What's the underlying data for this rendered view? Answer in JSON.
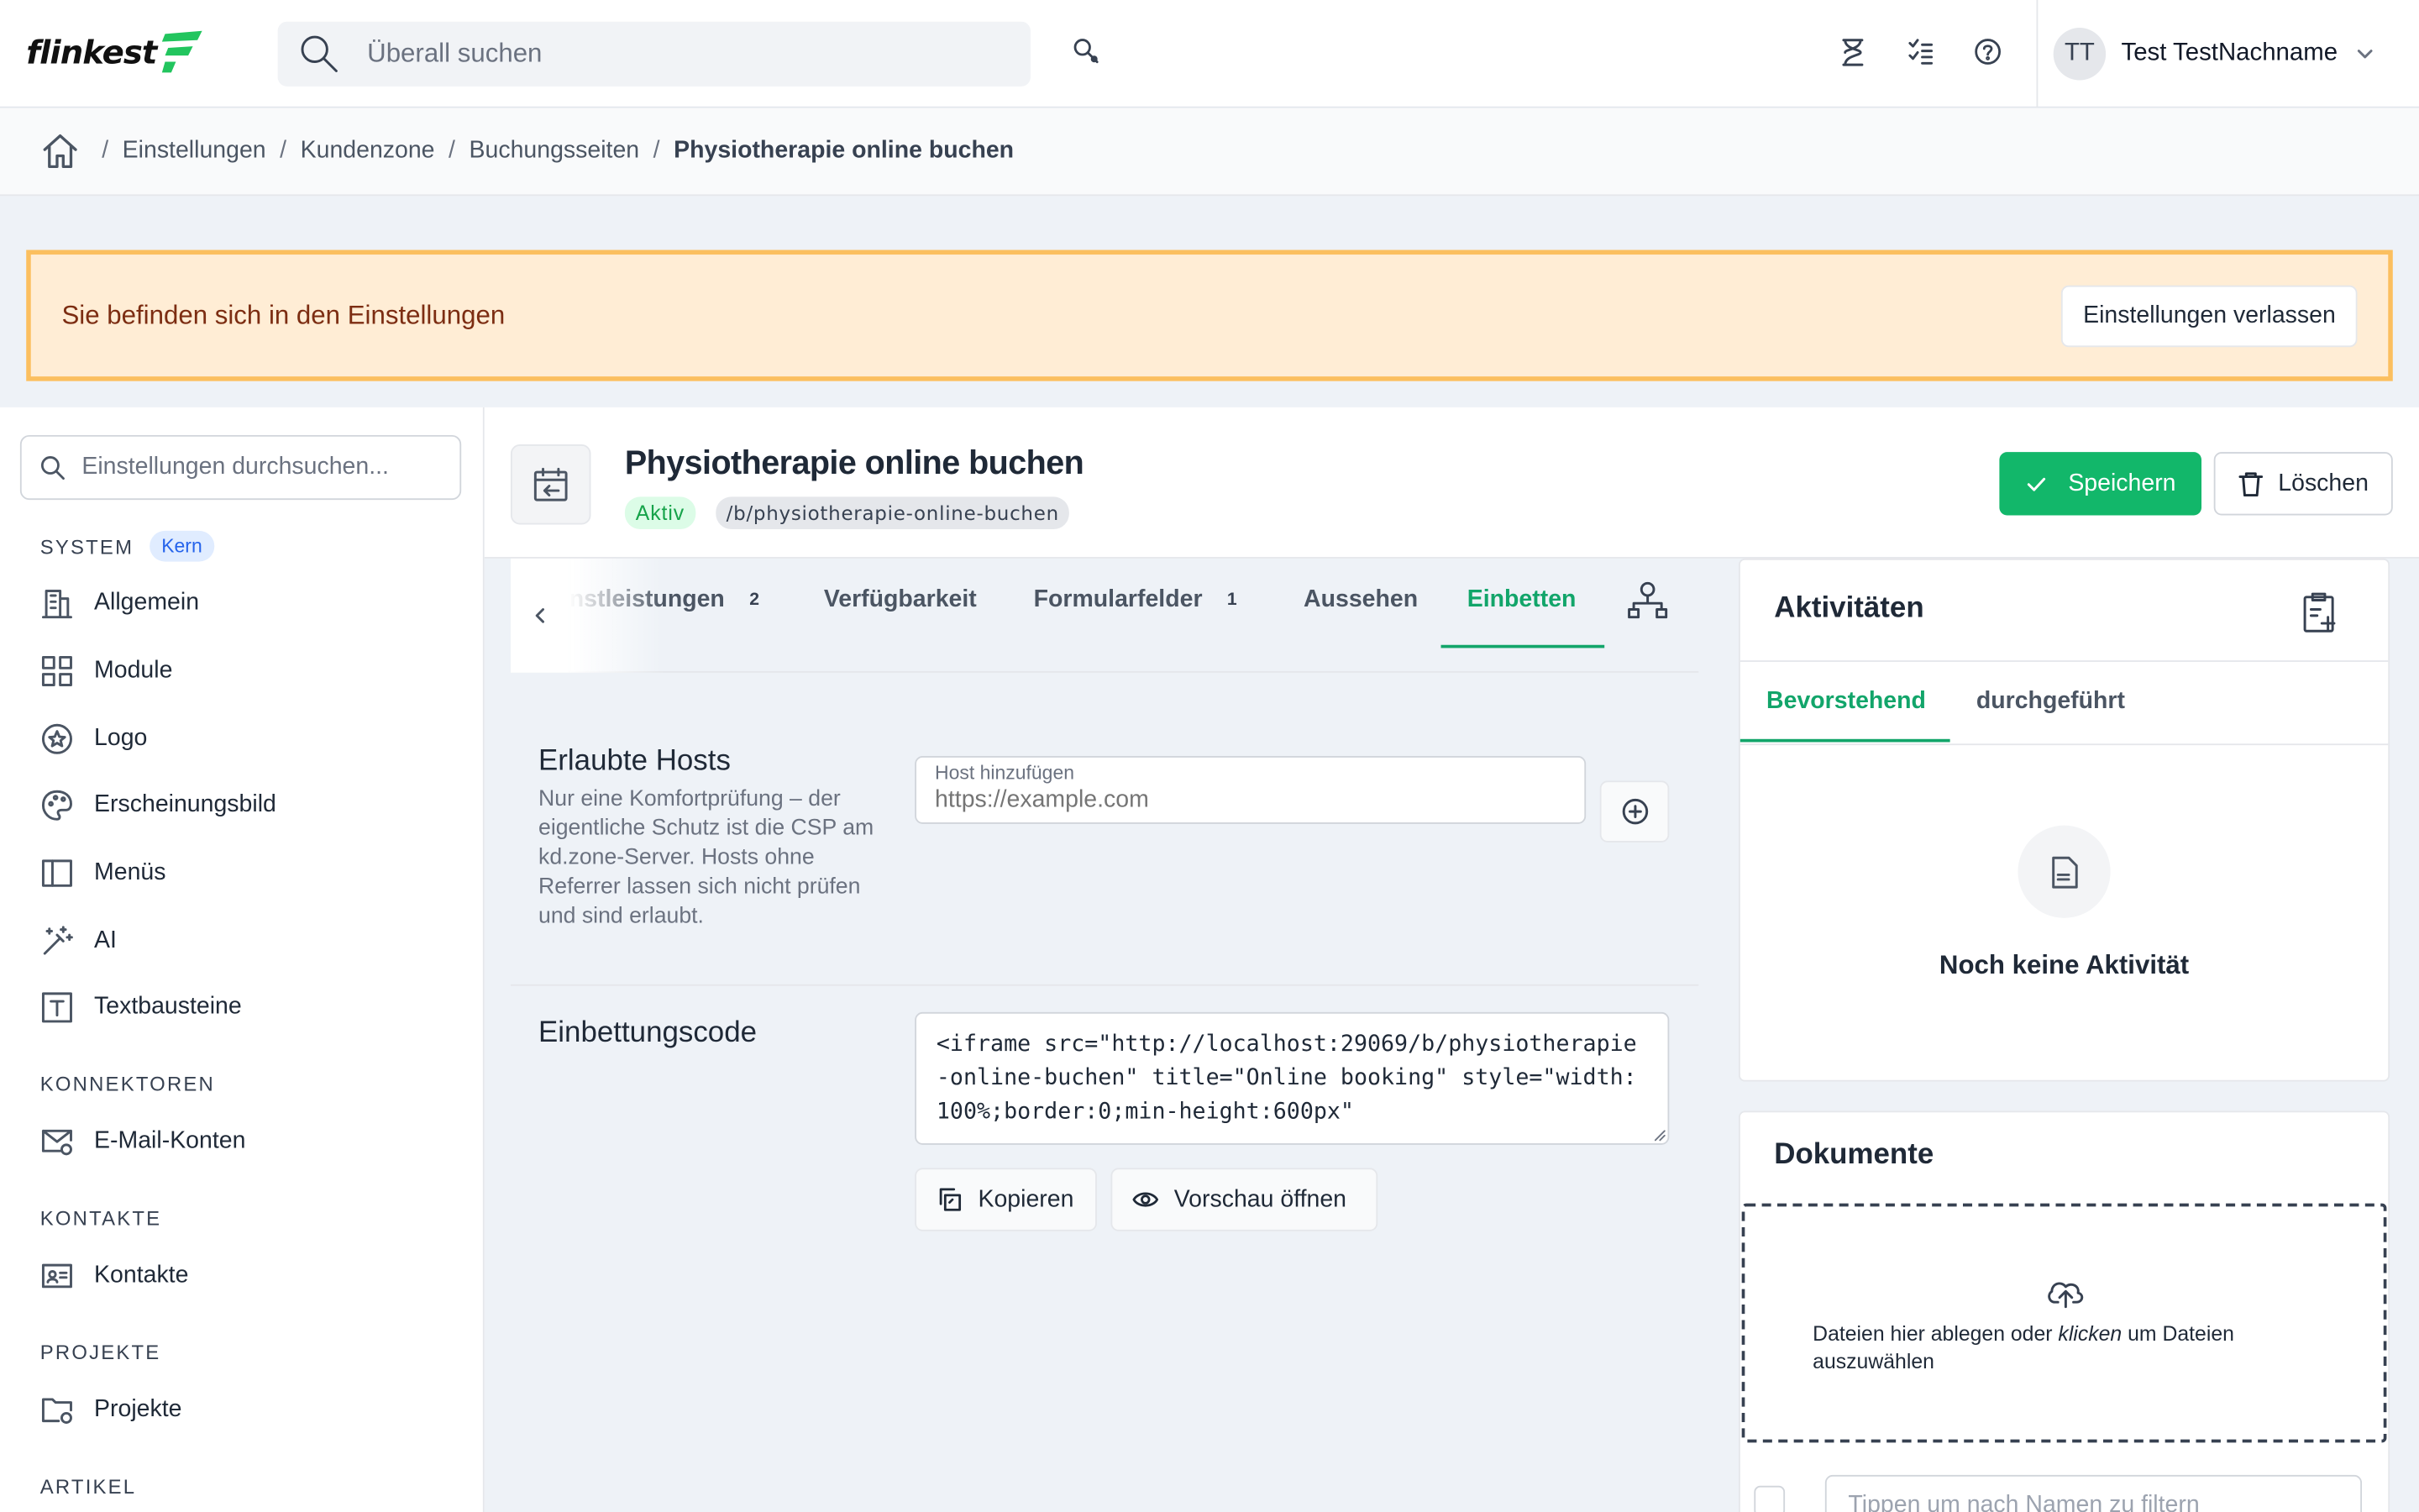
{
  "app": {
    "logo_text": "flinkest"
  },
  "topbar": {
    "search_placeholder": "Überall suchen",
    "user_initials": "TT",
    "user_name": "Test TestNachname"
  },
  "breadcrumb": [
    "Einstellungen",
    "Kundenzone",
    "Buchungsseiten",
    "Physiotherapie online buchen"
  ],
  "banner": {
    "text": "Sie befinden sich in den Einstellungen",
    "button": "Einstellungen verlassen"
  },
  "sidebar": {
    "search_placeholder": "Einstellungen durchsuchen...",
    "sections": [
      {
        "title": "SYSTEM",
        "badge": "Kern"
      },
      {
        "title": "KONNEKTOREN"
      },
      {
        "title": "KONTAKTE"
      },
      {
        "title": "PROJEKTE"
      },
      {
        "title": "ARTIKEL"
      }
    ],
    "items": [
      {
        "label": "Allgemein",
        "icon": "building-icon"
      },
      {
        "label": "Module",
        "icon": "grid-icon"
      },
      {
        "label": "Logo",
        "icon": "star-badge-icon"
      },
      {
        "label": "Erscheinungsbild",
        "icon": "palette-icon"
      },
      {
        "label": "Menüs",
        "icon": "sidebar-layout-icon"
      },
      {
        "label": "AI",
        "icon": "magic-wand-icon"
      },
      {
        "label": "Textbausteine",
        "icon": "text-box-icon"
      },
      {
        "label": "E-Mail-Konten",
        "icon": "mail-settings-icon"
      },
      {
        "label": "Kontakte",
        "icon": "contact-card-icon"
      },
      {
        "label": "Projekte",
        "icon": "folder-settings-icon"
      }
    ]
  },
  "page": {
    "title": "Physiotherapie online buchen",
    "status": "Aktiv",
    "slug": "/b/physiotherapie-online-buchen",
    "save_label": "Speichern",
    "delete_label": "Löschen"
  },
  "tabs": [
    {
      "label": "nstleistungen",
      "count": "2"
    },
    {
      "label": "Verfügbarkeit"
    },
    {
      "label": "Formularfelder",
      "count": "1"
    },
    {
      "label": "Aussehen"
    },
    {
      "label": "Einbetten",
      "active": true
    }
  ],
  "hosts": {
    "title": "Erlaubte Hosts",
    "description": "Nur eine Komfortprüfung – der eigentliche Schutz ist die CSP am kd.zone-Server. Hosts ohne Referrer lassen sich nicht prüfen und sind erlaubt.",
    "field_label": "Host hinzufügen",
    "field_placeholder": "https://example.com"
  },
  "embed": {
    "title": "Einbettungscode",
    "code": "<iframe src=\"http://localhost:29069/b/physiotherapie-online-buchen\" title=\"Online booking\" style=\"width:100%;border:0;min-height:600px\"",
    "copy_label": "Kopieren",
    "preview_label": "Vorschau öffnen"
  },
  "activities": {
    "title": "Aktivitäten",
    "tabs": [
      "Bevorstehend",
      "durchgeführt"
    ],
    "empty": "Noch keine Aktivität"
  },
  "documents": {
    "title": "Dokumente",
    "drop_text_1": "Dateien hier ablegen oder ",
    "drop_text_em": "klicken",
    "drop_text_2": " um Dateien auszuwählen",
    "filter_placeholder": "Tippen um nach Namen zu filtern"
  },
  "colors": {
    "brand_green": "#12b76a",
    "banner_bg": "#ffedd5",
    "banner_border": "#fbbf5f",
    "accent_blue": "#2563eb"
  }
}
